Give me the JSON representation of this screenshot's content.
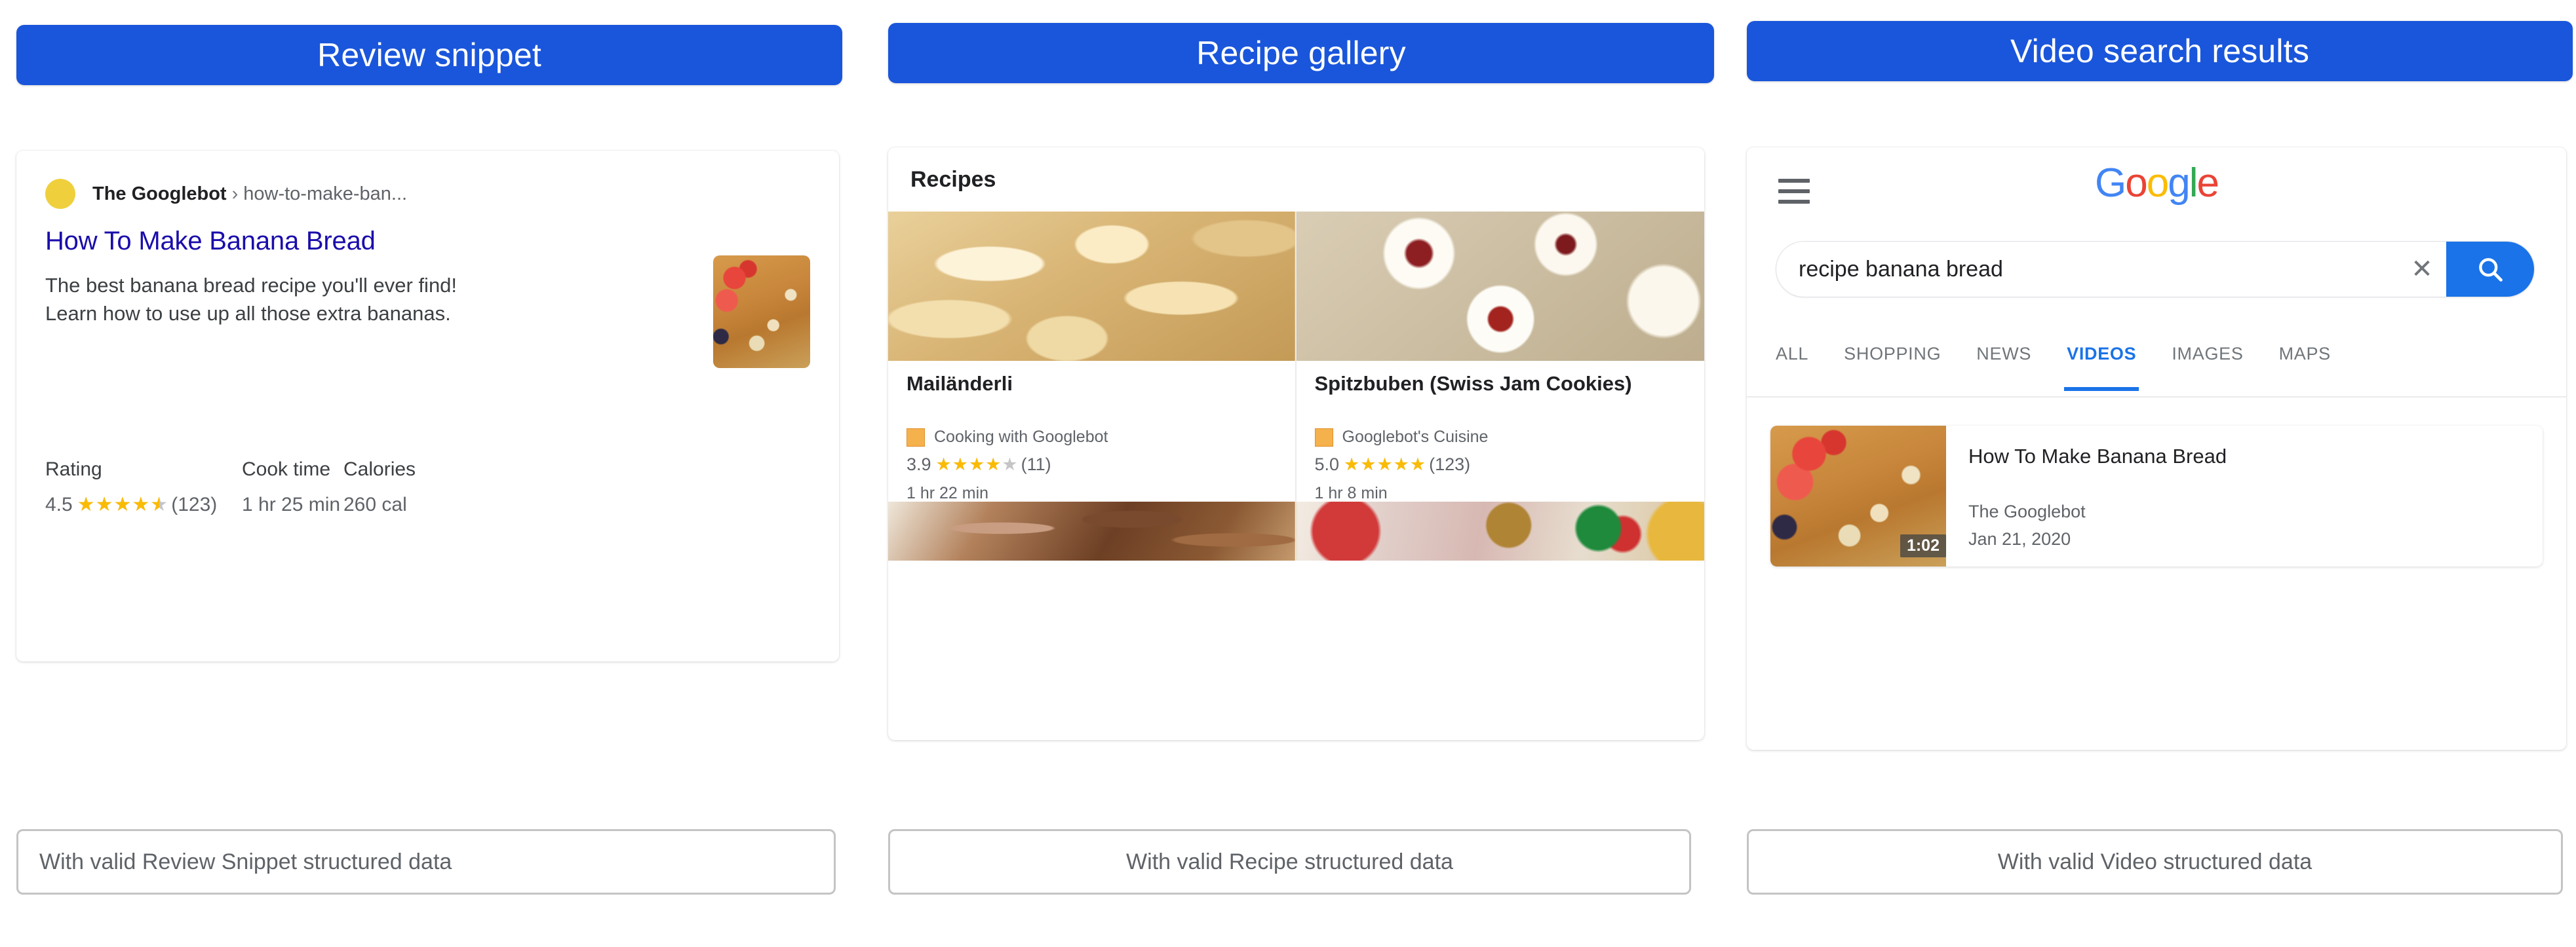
{
  "columns": [
    {
      "header": "Review snippet",
      "caption": "With valid Review Snippet structured data"
    },
    {
      "header": "Recipe gallery",
      "caption": "With valid Recipe structured data"
    },
    {
      "header": "Video search results",
      "caption": "With valid Video structured data"
    }
  ],
  "review_snippet": {
    "site_name": "The Googlebot",
    "chevron": "›",
    "url_path": "how-to-make-ban...",
    "title": "How To Make Banana Bread",
    "description": "The best banana bread recipe you'll ever find! Learn how to use up all those extra bananas.",
    "thumbnail_alt": "banana-bread-photo",
    "meta": [
      {
        "label": "Rating",
        "value": ""
      },
      {
        "label": "Cook time",
        "value": "1 hr 25 min"
      },
      {
        "label": "Calories",
        "value": "260 cal"
      }
    ],
    "rating": {
      "score": "4.5",
      "count": "(123)",
      "stars_filled": 4.5,
      "stars_total": 5,
      "star_color": "#fabb05",
      "star_empty_color": "#c5c5c5"
    }
  },
  "recipe_gallery": {
    "section_title": "Recipes",
    "items": [
      {
        "title": "Mailänderli",
        "source": "Cooking with Googlebot",
        "rating_score": "3.9",
        "rating_count": "(11)",
        "stars_filled": 4,
        "cook_time": "1 hr 22 min",
        "image_alt": "butter-cookies-photo",
        "next_image_alt": "chocolate-cookies-photo"
      },
      {
        "title": "Spitzbuben (Swiss Jam Cookies)",
        "source": "Googlebot's Cuisine",
        "rating_score": "5.0",
        "rating_count": "(123)",
        "stars_filled": 5,
        "cook_time": "1 hr 8 min",
        "image_alt": "jam-cookies-photo",
        "next_image_alt": "christmas-cookies-photo"
      }
    ]
  },
  "video_search": {
    "logo": {
      "g1": "G",
      "o1": "o",
      "o2": "o",
      "g2": "g",
      "l": "l",
      "e": "e"
    },
    "search": {
      "value": "recipe banana bread",
      "placeholder": "Search",
      "clear_label": "✕"
    },
    "tabs": [
      {
        "label": "ALL",
        "active": false
      },
      {
        "label": "SHOPPING",
        "active": false
      },
      {
        "label": "NEWS",
        "active": false
      },
      {
        "label": "VIDEOS",
        "active": true
      },
      {
        "label": "IMAGES",
        "active": false
      },
      {
        "label": "MAPS",
        "active": false
      }
    ],
    "result": {
      "title": "How To Make Banana Bread",
      "channel": "The Googlebot",
      "date": "Jan 21, 2020",
      "duration": "1:02",
      "thumbnail_alt": "banana-bread-video-thumbnail"
    }
  },
  "colors": {
    "header_blue": "#1a56db",
    "link_blue": "#1a0dab",
    "accent_blue": "#1a73e8",
    "star_gold": "#fabb05",
    "favicon_yellow": "#efd03c",
    "recipe_favicon_orange": "#f5b14c",
    "caption_border": "#c4c4c4"
  }
}
